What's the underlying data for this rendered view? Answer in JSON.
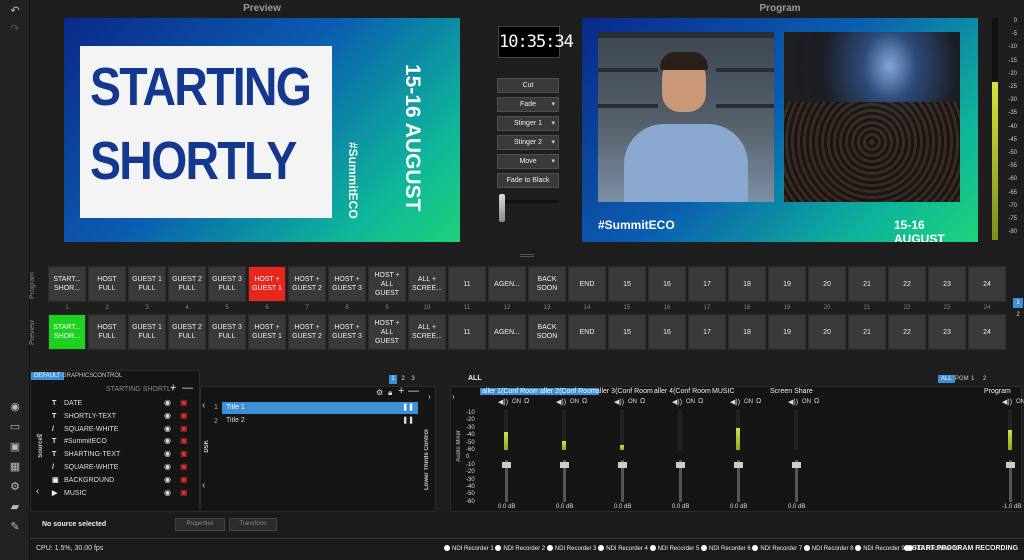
{
  "panels": {
    "preview_title": "Preview",
    "program_title": "Program"
  },
  "preview": {
    "line1": "STARTING",
    "line2": "SHORTLY",
    "date": "15-16 AUGUST",
    "hashtag": "#SummitECO"
  },
  "program": {
    "hashtag": "#SummitECO",
    "date": "15-16 AUGUST"
  },
  "clock": "10:35:34",
  "transitions": [
    {
      "label": "Cut",
      "dropdown": false
    },
    {
      "label": "Fade",
      "dropdown": true
    },
    {
      "label": "Stinger 1",
      "dropdown": true
    },
    {
      "label": "Stinger 2",
      "dropdown": true
    },
    {
      "label": "Move",
      "dropdown": true
    },
    {
      "label": "Fade to Black",
      "dropdown": false
    }
  ],
  "vu_ticks": [
    "0",
    "-5",
    "-10",
    "-15",
    "-20",
    "-25",
    "-30",
    "-35",
    "-40",
    "-45",
    "-50",
    "-55",
    "-60",
    "-65",
    "-70",
    "-75",
    "-80"
  ],
  "rows": {
    "program_label": "Program",
    "preview_label": "Preview"
  },
  "program_buttons": [
    "START... SHOR...",
    "HOST FULL",
    "GUEST 1 FULL",
    "GUEST 2 FULL",
    "GUEST 3 FULL",
    "HOST + GUEST 1",
    "HOST + GUEST 2",
    "HOST + GUEST 3",
    "HOST + ALL GUEST",
    "ALL + SCREE...",
    "11",
    "AGEN...",
    "BACK SOON",
    "END",
    "15",
    "16",
    "17",
    "18",
    "19",
    "20",
    "21",
    "22",
    "23",
    "24"
  ],
  "preview_buttons": [
    "START... SHOR...",
    "HOST FULL",
    "GUEST 1 FULL",
    "GUEST 2 FULL",
    "GUEST 3 FULL",
    "HOST + GUEST 1",
    "HOST + GUEST 2",
    "HOST + GUEST 3",
    "HOST + ALL GUEST",
    "ALL + SCREE...",
    "11",
    "AGEN...",
    "BACK SOON",
    "END",
    "15",
    "16",
    "17",
    "18",
    "19",
    "20",
    "21",
    "22",
    "23",
    "24"
  ],
  "button_numbers": [
    "1",
    "2",
    "3",
    "4",
    "5",
    "6",
    "7",
    "8",
    "9",
    "10",
    "11",
    "12",
    "13",
    "14",
    "15",
    "16",
    "17",
    "18",
    "19",
    "20",
    "21",
    "22",
    "23",
    "24"
  ],
  "program_active_index": 5,
  "preview_active_index": 0,
  "page_indicator": [
    "1",
    "2"
  ],
  "colors": {
    "program_active": "#e8261b",
    "preview_active": "#1ed11e",
    "accent": "#3d8fd6",
    "lock": "#e03030"
  },
  "scene_tabs": [
    "DEFAULT",
    "GRAPHICS",
    "CONTROL"
  ],
  "scene_name": "STARTING SHORTLY",
  "scene_pages": [
    "1",
    "2",
    "3"
  ],
  "sources_label": "Sources",
  "sources": [
    {
      "icon": "text-icon",
      "glyph": "T",
      "name": "DATE"
    },
    {
      "icon": "text-icon",
      "glyph": "T",
      "name": "SHORTLY-TEXT"
    },
    {
      "icon": "brush-icon",
      "glyph": "/",
      "name": "SQUARE-WHITE"
    },
    {
      "icon": "text-icon",
      "glyph": "T",
      "name": "#SummitECO"
    },
    {
      "icon": "text-icon",
      "glyph": "T",
      "name": "SHARTING-TEXT"
    },
    {
      "icon": "brush-icon",
      "glyph": "/",
      "name": "SQUARE-WHITE"
    },
    {
      "icon": "image-icon",
      "glyph": "▣",
      "name": "BACKGROUND"
    },
    {
      "icon": "play-icon",
      "glyph": "▶",
      "name": "MUSIC"
    }
  ],
  "dsk_label": "DSK",
  "dsk_numbers": [
    "1",
    "2"
  ],
  "titles": [
    {
      "num": "1",
      "name": "Title 1"
    },
    {
      "num": "2",
      "name": "Title 2"
    }
  ],
  "lower_thirds_label": "Lower Thirds Control",
  "audio": {
    "header": "ALL",
    "label": "Audio Mixer",
    "tabs": [
      "ALL",
      "PGM",
      "1",
      "2"
    ],
    "on_label": "ON",
    "scale": [
      "-10",
      "-20",
      "-30",
      "-40",
      "-50",
      "-60",
      "0",
      "-10",
      "-20",
      "-30",
      "-40",
      "-50",
      "-60"
    ],
    "channels": [
      {
        "name": "aller 1(Conf Room",
        "db": "0.0 dB",
        "level": 0.45,
        "highlight": true
      },
      {
        "name": "aller 2(Conf Room",
        "db": "0.0 dB",
        "level": 0.22,
        "highlight": true
      },
      {
        "name": "aller 3(Conf Room",
        "db": "0.0 dB",
        "level": 0.12,
        "highlight": false
      },
      {
        "name": "aller 4(Conf Room",
        "db": "0.0 dB",
        "level": 0.0,
        "highlight": false
      },
      {
        "name": "MUSIC",
        "db": "0.0 dB",
        "level": 0.55,
        "highlight": false
      },
      {
        "name": "Screen Share",
        "db": "0.0 dB",
        "level": 0.0,
        "highlight": false
      }
    ],
    "program_name": "Program",
    "program_db": "-1.0 dB",
    "program_level": 0.5
  },
  "selection": {
    "none_text": "No source selected",
    "properties_label": "Properties",
    "transform_label": "Transform"
  },
  "status": {
    "cpu": "CPU: 1.5%, 30.00 fps",
    "recorders": [
      "NDI Recorder 1",
      "NDI Recorder 2",
      "NDI Recorder 3",
      "NDI Recorder 4",
      "NDI Recorder 5",
      "NDI Recorder 6",
      "NDI Recorder 7",
      "NDI Recorder 8",
      "NDI Recorder 9",
      "NDI Recorder 10"
    ],
    "start_recording": "START PROGRAM RECORDING"
  }
}
